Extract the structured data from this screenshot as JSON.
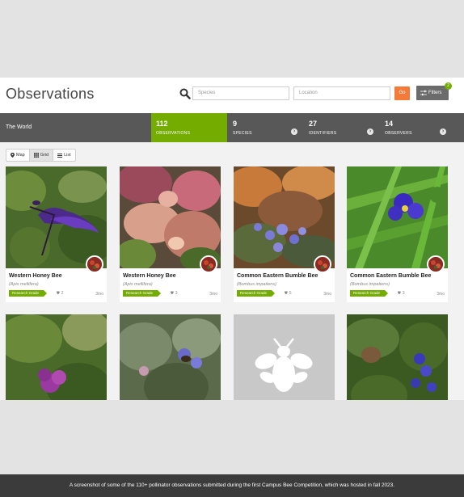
{
  "header": {
    "title": "Observations",
    "species_placeholder": "Species",
    "location_placeholder": "Location",
    "go_label": "Go",
    "filters_label": "Filters",
    "filters_badge": "2"
  },
  "stats_bar": {
    "place": "The World",
    "observations": {
      "count": "112",
      "label": "OBSERVATIONS"
    },
    "species": {
      "count": "9",
      "label": "SPECIES"
    },
    "identifiers": {
      "count": "27",
      "label": "IDENTIFIERS"
    },
    "observers": {
      "count": "14",
      "label": "OBSERVERS"
    }
  },
  "views": {
    "map": "Map",
    "grid": "Grid",
    "list": "List",
    "active": "grid"
  },
  "cards": [
    {
      "name": "Western Honey Bee",
      "sci": "(Apis mellifera)",
      "grade": "Research Grade",
      "ids": "2",
      "ago": "3mo"
    },
    {
      "name": "Western Honey Bee",
      "sci": "(Apis mellifera)",
      "grade": "Research Grade",
      "ids": "3",
      "ago": "3mo"
    },
    {
      "name": "Common Eastern Bumble Bee",
      "sci": "(Bombus impatiens)",
      "grade": "Research Grade",
      "ids": "5",
      "ago": "3mo"
    },
    {
      "name": "Common Eastern Bumble Bee",
      "sci": "(Bombus impatiens)",
      "grade": "Research Grade",
      "ids": "3",
      "ago": "3mo"
    }
  ],
  "colors": {
    "brand_green": "#74ac00",
    "go_orange": "#f47a39",
    "bar_gray": "#585858"
  },
  "caption": "A screenshot of some of the 110+ pollinator observations submitted during the first Campus Bee Competition, which was hosted in fall 2023."
}
